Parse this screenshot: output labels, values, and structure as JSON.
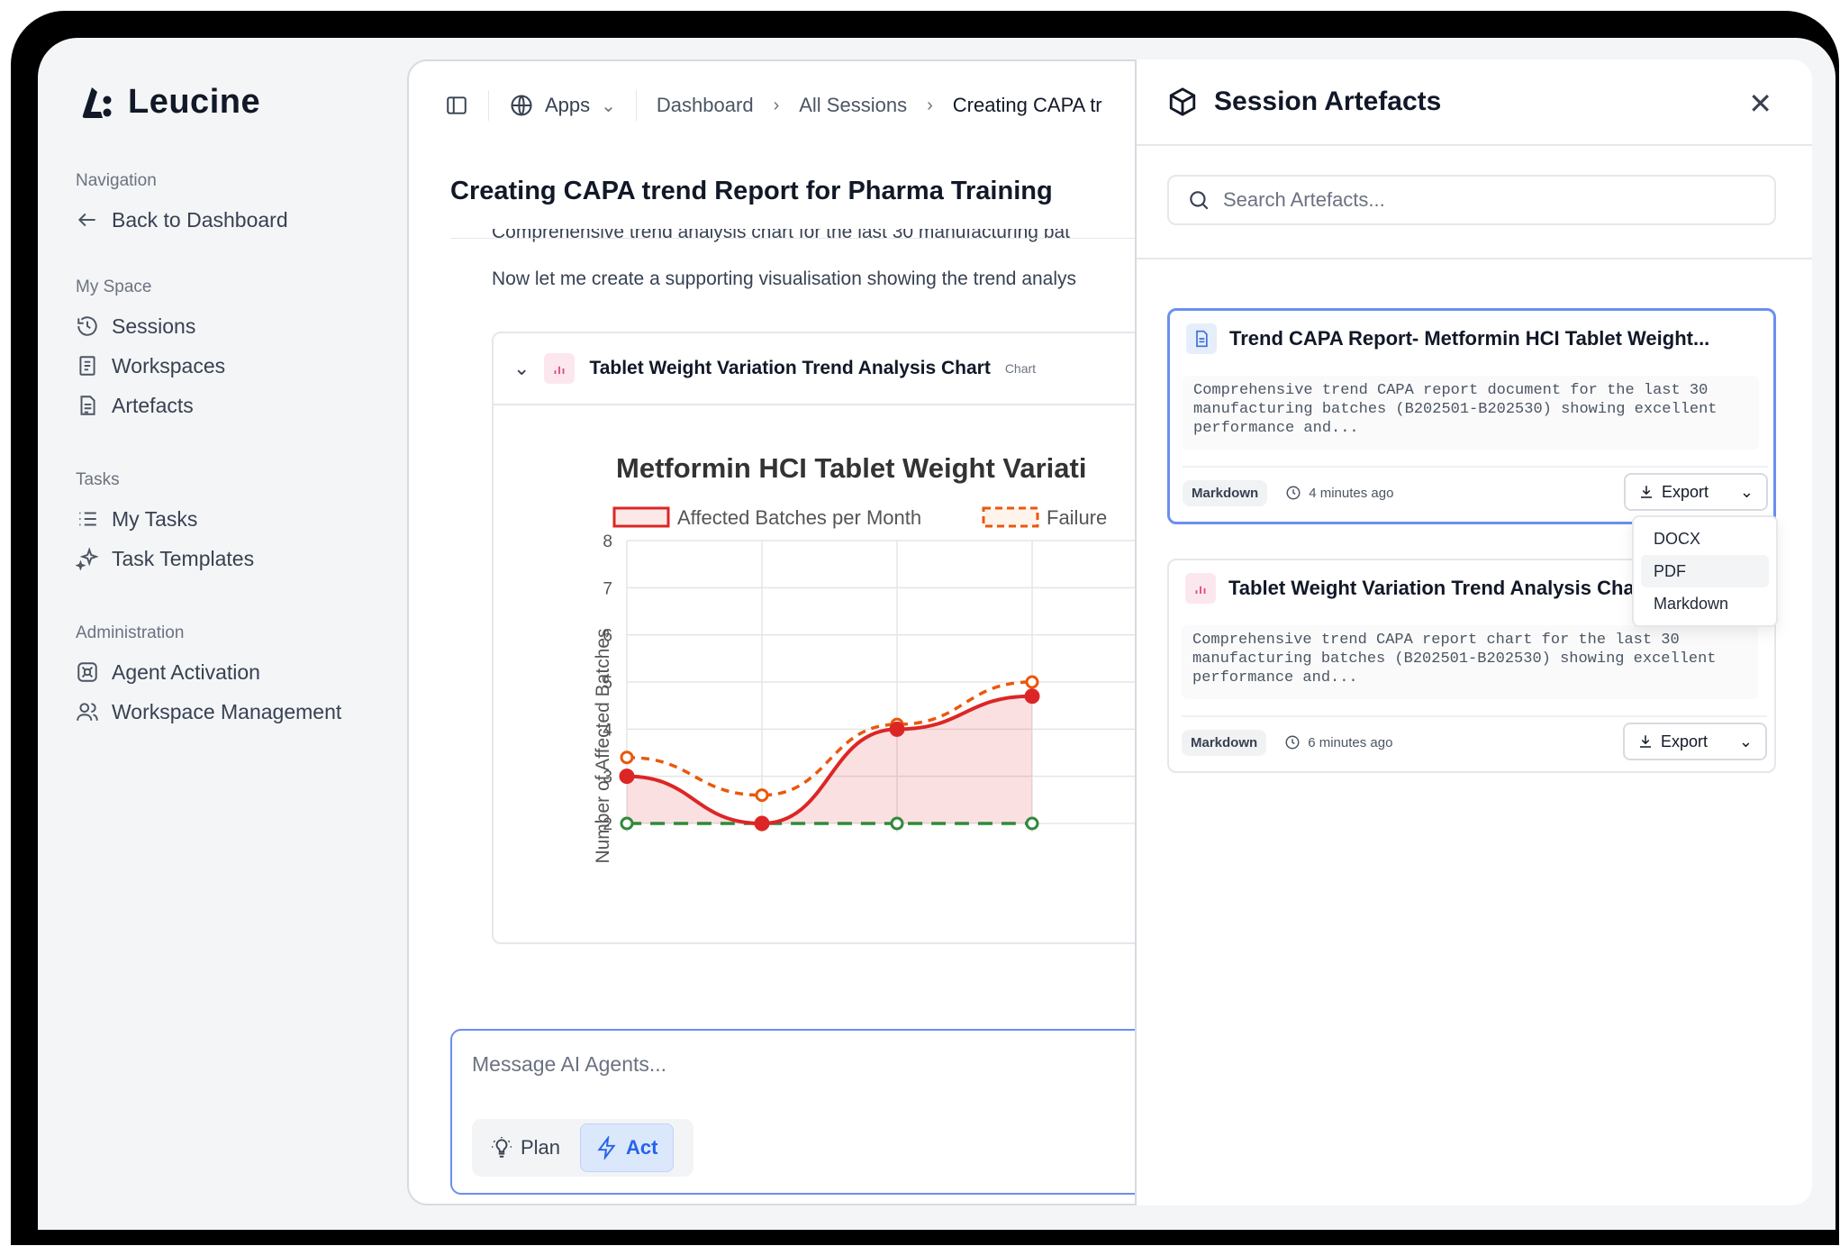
{
  "app": {
    "name": "Leucine"
  },
  "sidebar": {
    "sections": [
      {
        "title": "Navigation",
        "items": [
          {
            "label": "Back to Dashboard",
            "icon": "arrow-left-icon"
          }
        ]
      },
      {
        "title": "My Space",
        "items": [
          {
            "label": "Sessions",
            "icon": "history-icon"
          },
          {
            "label": "Workspaces",
            "icon": "notebook-icon"
          },
          {
            "label": "Artefacts",
            "icon": "file-list-icon"
          }
        ]
      },
      {
        "title": "Tasks",
        "items": [
          {
            "label": "My Tasks",
            "icon": "list-icon"
          },
          {
            "label": "Task Templates",
            "icon": "sparkle-icon"
          }
        ]
      },
      {
        "title": "Administration",
        "items": [
          {
            "label": "Agent Activation",
            "icon": "agent-icon"
          },
          {
            "label": "Workspace Management",
            "icon": "users-icon"
          }
        ]
      }
    ]
  },
  "topbar": {
    "apps_label": "Apps",
    "breadcrumb": [
      "Dashboard",
      "All Sessions",
      "Creating CAPA tr"
    ]
  },
  "session": {
    "title": "Creating CAPA trend Report for Pharma Training",
    "cut_text": "Comprehensive trend analysis chart for the last 30 manufacturing bat",
    "message": "Now let me create a supporting visualisation showing the trend analys",
    "chart_card": {
      "title": "Tablet Weight Variation Trend Analysis Chart",
      "tag": "Chart"
    }
  },
  "chart_data": {
    "type": "line",
    "title": "Metformin HCI Tablet Weight Variati",
    "ylabel": "Number of Affected Batches",
    "ylim": [
      2,
      8
    ],
    "yticks": [
      2,
      3,
      4,
      5,
      6,
      7,
      8
    ],
    "series": [
      {
        "name": "Affected Batches per Month",
        "color": "#dc2626",
        "style": "solid",
        "fill": true,
        "values": [
          3,
          2,
          4,
          4.7
        ]
      },
      {
        "name": "Failure",
        "color": "#ea580c",
        "style": "dashed",
        "values": [
          3.4,
          2.6,
          4.1,
          5
        ]
      },
      {
        "color": "#2f8a3a",
        "style": "dashed",
        "values": [
          2,
          2,
          2,
          2
        ]
      }
    ]
  },
  "composer": {
    "placeholder": "Message AI Agents...",
    "modes": [
      {
        "label": "Plan",
        "active": false
      },
      {
        "label": "Act",
        "active": true
      }
    ]
  },
  "panel": {
    "title": "Session Artefacts",
    "search_placeholder": "Search Artefacts...",
    "artefacts": [
      {
        "title": "Trend CAPA Report- Metformin HCI Tablet Weight...",
        "desc": [
          "Comprehensive trend CAPA report document for the last 30",
          "manufacturing batches (B202501-B202530) showing excellent",
          "performance and..."
        ],
        "format": "Markdown",
        "time": "4 minutes ago",
        "export_label": "Export"
      },
      {
        "title": "Tablet Weight Variation Trend Analysis Chart",
        "desc": [
          "Comprehensive trend CAPA report chart for the last 30",
          "manufacturing batches (B202501-B202530) showing excellent",
          "performance and..."
        ],
        "format": "Markdown",
        "time": "6 minutes ago",
        "export_label": "Export"
      }
    ],
    "export_options": [
      "DOCX",
      "PDF",
      "Markdown"
    ]
  }
}
